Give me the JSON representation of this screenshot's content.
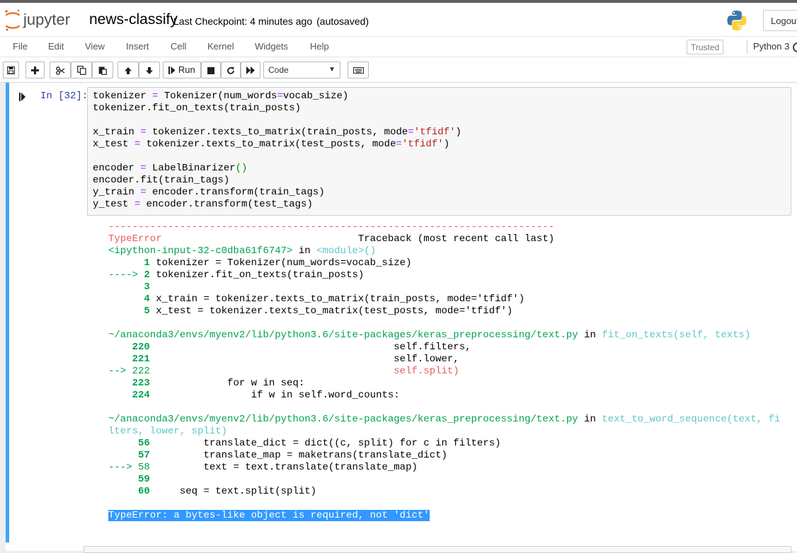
{
  "header": {
    "logo_text": "jupyter",
    "notebook_name": "news-classify",
    "checkpoint": "Last Checkpoint: 4 minutes ago",
    "autosave_status": "(autosaved)",
    "logout_label": "Logout"
  },
  "menu": {
    "items": [
      "File",
      "Edit",
      "View",
      "Insert",
      "Cell",
      "Kernel",
      "Widgets",
      "Help"
    ],
    "trusted_label": "Trusted",
    "kernel_name": "Python 3"
  },
  "toolbar": {
    "run_label": "Run",
    "cell_type": "Code",
    "icons": [
      "save-icon",
      "plus-icon",
      "cut-icon",
      "copy-icon",
      "paste-icon",
      "arrow-up-icon",
      "arrow-down-icon",
      "run-icon",
      "stop-icon",
      "restart-icon",
      "fast-forward-icon",
      "keyboard-icon"
    ]
  },
  "cell": {
    "prompt": "In [32]:",
    "code_lines": [
      "tokenizer = Tokenizer(num_words=vocab_size)",
      "tokenizer.fit_on_texts(train_posts)",
      "",
      "x_train = tokenizer.texts_to_matrix(train_posts, mode='tfidf')",
      "x_test = tokenizer.texts_to_matrix(test_posts, mode='tfidf')",
      "",
      "encoder = LabelBinarizer()",
      "encoder.fit(train_tags)",
      "y_train = encoder.transform(train_tags)",
      "y_test = encoder.transform(test_tags)"
    ]
  },
  "output": {
    "separator": "---------------------------------------------------------------------------",
    "error_type": "TypeError",
    "traceback_header": "Traceback (most recent call last)",
    "frame1_location": "<ipython-input-32-c0dba61f6747>",
    "frame1_in": " in ",
    "frame1_module": "<module>()",
    "frame1_lines": [
      {
        "marker": "      ",
        "num": "1",
        "code": " tokenizer = Tokenizer(num_words=vocab_size)"
      },
      {
        "marker": "----> ",
        "num": "2",
        "code": " tokenizer.fit_on_texts(train_posts)"
      },
      {
        "marker": "      ",
        "num": "3",
        "code": ""
      },
      {
        "marker": "      ",
        "num": "4",
        "code": " x_train = tokenizer.texts_to_matrix(train_posts, mode='tfidf')"
      },
      {
        "marker": "      ",
        "num": "5",
        "code": " x_test = tokenizer.texts_to_matrix(test_posts, mode='tfidf')"
      }
    ],
    "frame2_path": "~/anaconda3/envs/myenv2/lib/python3.6/site-packages/keras_preprocessing/text.py",
    "frame2_func": "fit_on_texts(self, texts)",
    "frame2_lines": [
      {
        "marker": "    ",
        "num": "220",
        "code": "                                         self.filters,"
      },
      {
        "marker": "    ",
        "num": "221",
        "code": "                                         self.lower,"
      },
      {
        "marker": "--> ",
        "num": "222",
        "code": "                                         self.split)"
      },
      {
        "marker": "    ",
        "num": "223",
        "code": "             for w in seq:"
      },
      {
        "marker": "    ",
        "num": "224",
        "code": "                 if w in self.word_counts:"
      }
    ],
    "frame3_path": "~/anaconda3/envs/myenv2/lib/python3.6/site-packages/keras_preprocessing/text.py",
    "frame3_func_a": "text_to_word_sequence(text, fi",
    "frame3_func_b": "lters, lower, split)",
    "frame3_lines": [
      {
        "marker": "     ",
        "num": "56",
        "code": "         translate_dict = dict((c, split) for c in filters)"
      },
      {
        "marker": "     ",
        "num": "57",
        "code": "         translate_map = maketrans(translate_dict)"
      },
      {
        "marker": "---> ",
        "num": "58",
        "code": "         text = text.translate(translate_map)"
      },
      {
        "marker": "     ",
        "num": "59",
        "code": ""
      },
      {
        "marker": "     ",
        "num": "60",
        "code": "     seq = text.split(split)"
      }
    ],
    "final_error": "TypeError: a bytes-like object is required, not 'dict'"
  }
}
